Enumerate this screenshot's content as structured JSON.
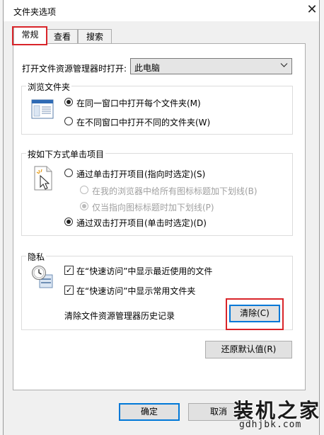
{
  "window": {
    "title": "文件夹选项",
    "close_glyph": "✕"
  },
  "tabs": [
    {
      "label": "常规",
      "active": true
    },
    {
      "label": "查看",
      "active": false
    },
    {
      "label": "搜索",
      "active": false
    }
  ],
  "open_explorer": {
    "label": "打开文件资源管理器时打开:",
    "value": "此电脑"
  },
  "browse_folders": {
    "title": "浏览文件夹",
    "options": [
      {
        "label": "在同一窗口中打开每个文件夹(M)",
        "checked": true
      },
      {
        "label": "在不同窗口中打开不同的文件夹(W)",
        "checked": false
      }
    ]
  },
  "click_items": {
    "title": "按如下方式单击项目",
    "single_click": {
      "label": "通过单击打开项目(指向时选定)(S)",
      "checked": false
    },
    "underline_all": {
      "label": "在我的浏览器中给所有图标标题加下划线(B)",
      "checked": false,
      "disabled": true
    },
    "underline_hover": {
      "label": "仅当指向图标标题时加下划线(P)",
      "checked": true,
      "disabled": true
    },
    "double_click": {
      "label": "通过双击打开项目(单击时选定)(D)",
      "checked": true
    }
  },
  "privacy": {
    "title": "隐私",
    "show_recent_files": {
      "label": "在“快速访问”中显示最近使用的文件",
      "checked": true
    },
    "show_frequent_folders": {
      "label": "在“快速访问”中显示常用文件夹",
      "checked": true
    },
    "clear_history_label": "清除文件资源管理器历史记录",
    "clear_button": "清除(C)"
  },
  "restore_defaults_button": "还原默认值(R)",
  "footer": {
    "ok_button": "确定",
    "cancel_button": "取消"
  },
  "watermark": {
    "text": "装机之家",
    "url": "gdhjbk.com"
  }
}
